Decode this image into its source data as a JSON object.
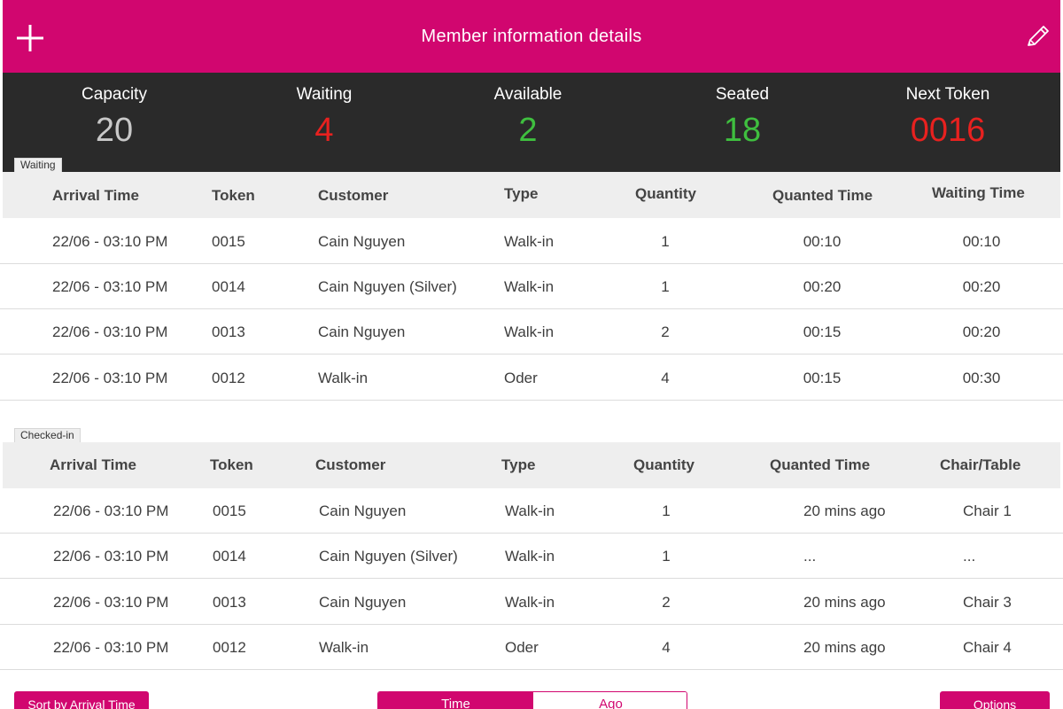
{
  "header": {
    "title": "Member information details",
    "add_icon": "plus-icon",
    "edit_icon": "pencil-icon"
  },
  "stats": [
    {
      "label": "Capacity",
      "value": "20",
      "color": "#c8c8c8"
    },
    {
      "label": "Waiting",
      "value": "4",
      "color": "#e8211f"
    },
    {
      "label": "Available",
      "value": "2",
      "color": "#3fbf3f"
    },
    {
      "label": "Seated",
      "value": "18",
      "color": "#3fbf3f"
    },
    {
      "label": "Next Token",
      "value": "0016",
      "color": "#e8211f"
    }
  ],
  "waiting": {
    "tab_label": "Waiting",
    "columns": [
      "Arrival Time",
      "Token",
      "Customer",
      "Type",
      "Quantity",
      "Quanted Time",
      "Waiting Time"
    ],
    "rows": [
      [
        "22/06 - 03:10 PM",
        "0015",
        "Cain Nguyen",
        "Walk-in",
        "1",
        "00:10",
        "00:10"
      ],
      [
        "22/06 - 03:10 PM",
        "0014",
        "Cain Nguyen (Silver)",
        "Walk-in",
        "1",
        "00:20",
        "00:20"
      ],
      [
        "22/06 - 03:10 PM",
        "0013",
        "Cain Nguyen",
        "Walk-in",
        "2",
        "00:15",
        "00:20"
      ],
      [
        "22/06 - 03:10 PM",
        "0012",
        "Walk-in",
        "Oder",
        "4",
        "00:15",
        "00:30"
      ]
    ]
  },
  "checked_in": {
    "tab_label": "Checked-in",
    "columns": [
      "Arrival Time",
      "Token",
      "Customer",
      "Type",
      "Quantity",
      "Quanted Time",
      "Chair/Table"
    ],
    "rows": [
      [
        "22/06 - 03:10 PM",
        "0015",
        "Cain Nguyen",
        "Walk-in",
        "1",
        "20 mins ago",
        "Chair 1"
      ],
      [
        "22/06 - 03:10 PM",
        "0014",
        "Cain Nguyen (Silver)",
        "Walk-in",
        "1",
        "...",
        "..."
      ],
      [
        "22/06 - 03:10 PM",
        "0013",
        "Cain Nguyen",
        "Walk-in",
        "2",
        "20 mins ago",
        "Chair 3"
      ],
      [
        "22/06 - 03:10 PM",
        "0012",
        "Walk-in",
        "Oder",
        "4",
        "20 mins ago",
        "Chair 4"
      ]
    ]
  },
  "footer": {
    "sort_label": "Sort by Arrival Time",
    "segment": [
      {
        "label": "Time",
        "selected": true
      },
      {
        "label": "Ago",
        "selected": false
      }
    ],
    "options_label": "Options"
  },
  "colors": {
    "brand": "#d1066f",
    "stats_bg": "#2a2a2a",
    "header_row_bg": "#eeeeee"
  }
}
